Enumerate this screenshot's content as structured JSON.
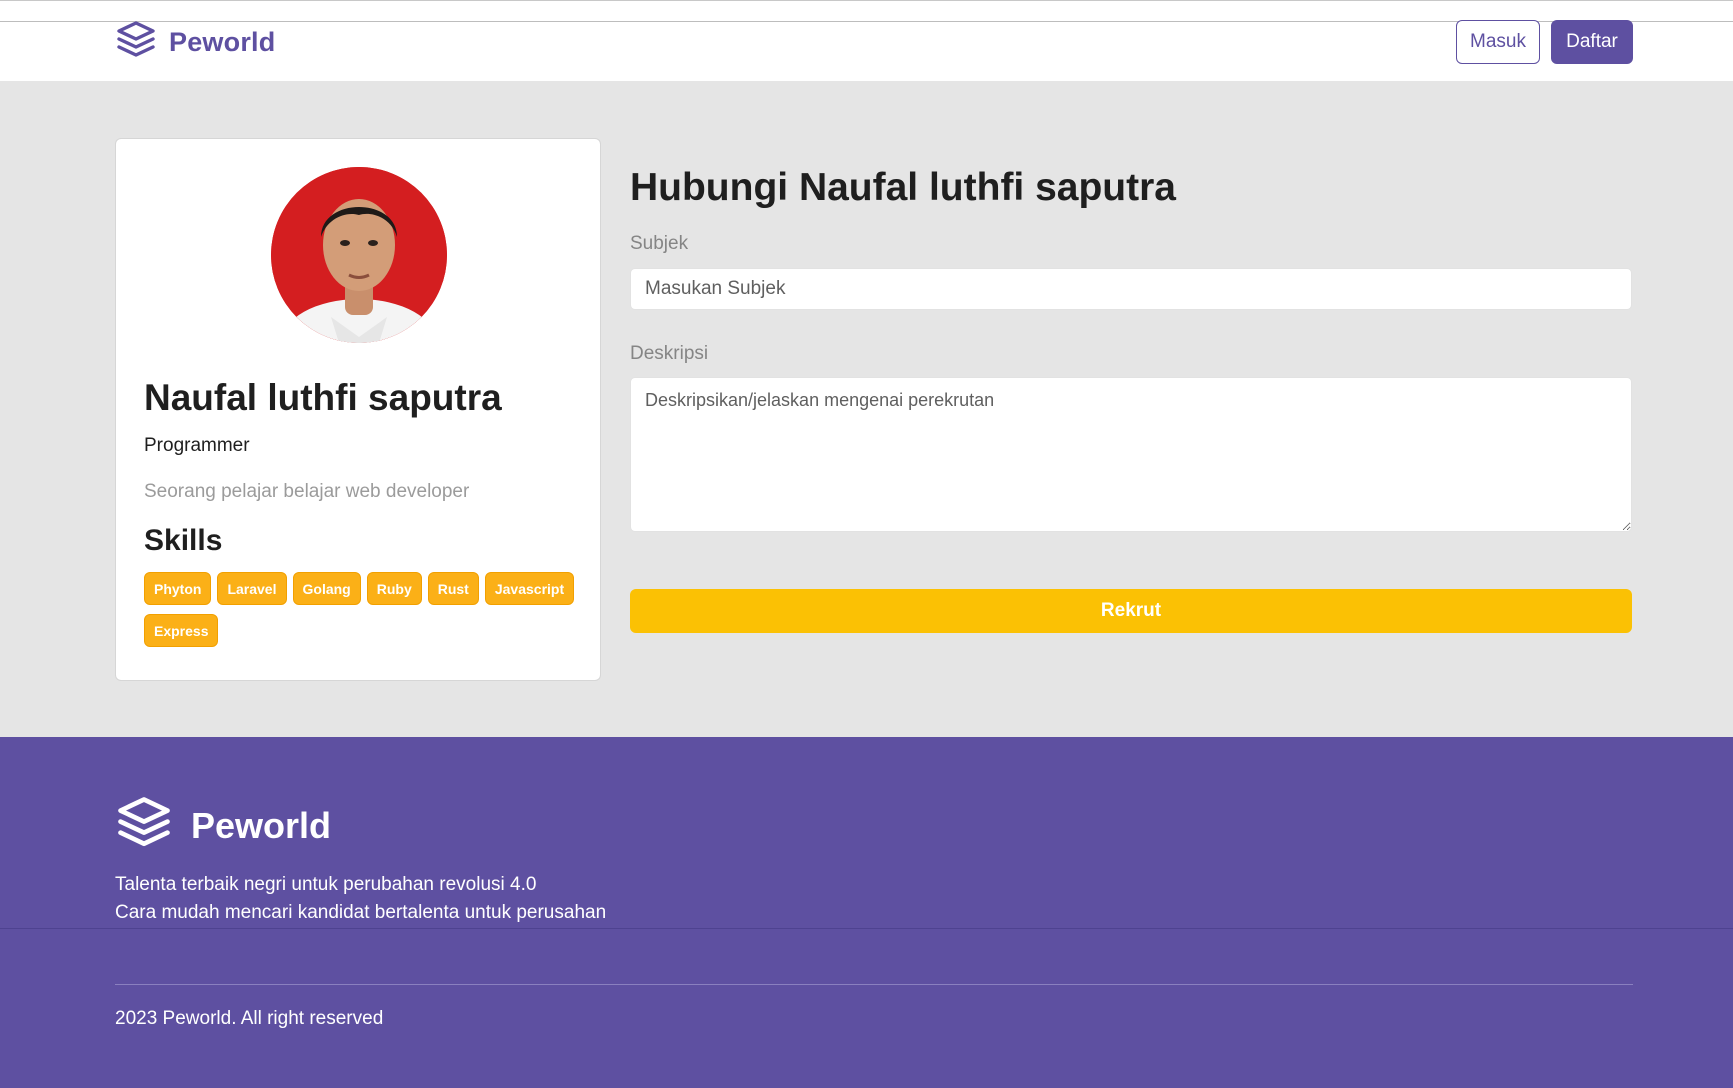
{
  "navbar": {
    "brand": "Peworld",
    "login_label": "Masuk",
    "register_label": "Daftar"
  },
  "profile": {
    "name": "Naufal luthfi saputra",
    "role": "Programmer",
    "bio": "Seorang pelajar belajar web developer",
    "skills_title": "Skills",
    "skills": [
      "Phyton",
      "Laravel",
      "Golang",
      "Ruby",
      "Rust",
      "Javascript",
      "Express"
    ]
  },
  "form": {
    "title": "Hubungi Naufal luthfi saputra",
    "subject_label": "Subjek",
    "subject_placeholder": "Masukan Subjek",
    "description_label": "Deskripsi",
    "description_placeholder": "Deskripsikan/jelaskan mengenai perekrutan",
    "submit_label": "Rekrut"
  },
  "footer": {
    "brand": "Peworld",
    "tagline_1": "Talenta terbaik negri untuk perubahan revolusi 4.0",
    "tagline_2": "Cara mudah mencari kandidat bertalenta untuk perusahan",
    "copyright": "2023 Peworld. All right reserved"
  },
  "colors": {
    "brand_purple": "#5e50a1",
    "skill_yellow": "#fbb017",
    "button_yellow": "#fbc104"
  }
}
